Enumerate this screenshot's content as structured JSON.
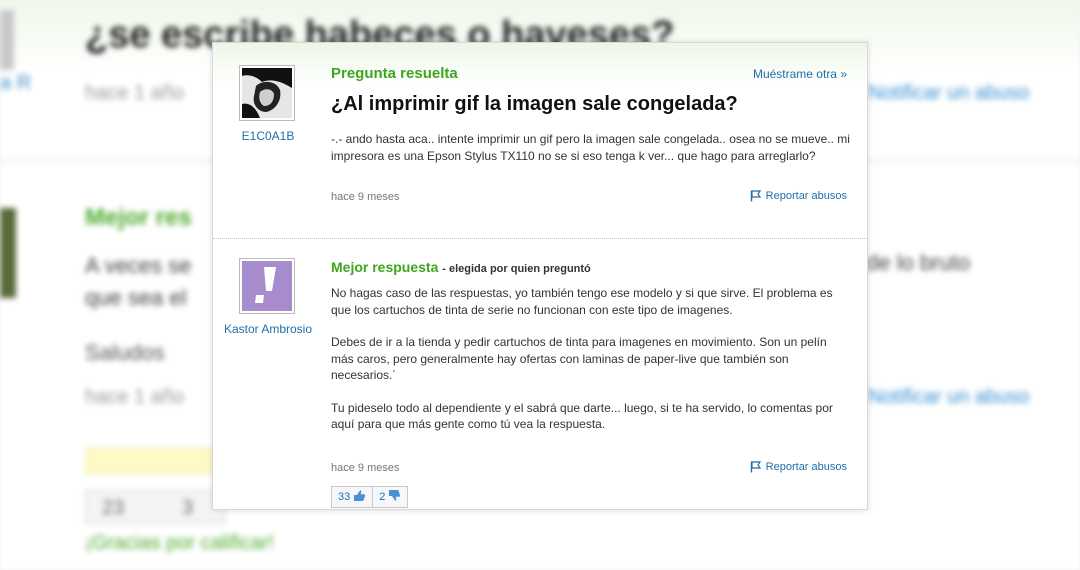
{
  "background": {
    "title": "¿se escribe habeces o haveses?",
    "time_1": "hace 1 año",
    "report_link": "Notificar un abuso",
    "best_answer_label": "Mejor res",
    "answer_text_line1": "A veces se",
    "answer_text_line2": "que sea el",
    "answer_text_right": "de lo bruto",
    "salutation": "Saludos",
    "time_2": "hace 1 año",
    "vote_up_count": "23",
    "vote_down_count": "3",
    "thanks_link": "¡Gracias por calificar!"
  },
  "question": {
    "status_label": "Pregunta resuelta",
    "show_another_label": "Muéstrame otra »",
    "title": "¿Al imprimir gif la imagen sale congelada?",
    "body": "-.- ando hasta aca.. intente imprimir un gif pero la imagen sale congelada.. osea no se mueve.. mi impresora es una Epson Stylus TX110 no se si eso tenga k ver... que hago para arreglarlo?",
    "time": "hace 9 meses",
    "report_label": "Reportar abusos",
    "author": "E1C0A1B"
  },
  "answer": {
    "best_label": "Mejor respuesta",
    "chosen_by": "- elegida por quien preguntó",
    "author": "Kastor Ambrosio",
    "paragraphs": [
      "No hagas caso de las respuestas, yo también tengo ese modelo y si que sirve. El problema es que los cartuchos de tinta de serie no funcionan con este tipo de imagenes.",
      "Debes de ir a la tienda y pedir cartuchos de tinta para imagenes en movimiento. Son un pelín más caros, pero generalmente hay ofertas con laminas de paper-live que también son necesarios.´",
      "Tu pideselo todo al dependiente y el sabrá que darte... luego, si te ha servido, lo comentas por aquí para que más gente como tú vea la respuesta."
    ],
    "time": "hace 9 meses",
    "report_label": "Reportar abusos",
    "thumbs_up_count": "33",
    "thumbs_down_count": "2"
  },
  "colors": {
    "green_accent": "#3da61e",
    "link_blue": "#1f6fa8"
  }
}
